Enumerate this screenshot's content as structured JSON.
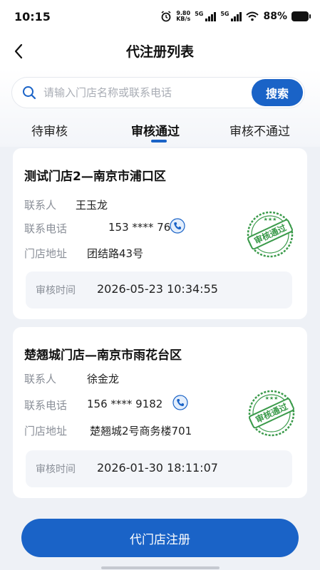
{
  "status_bar": {
    "time": "10:15",
    "net_speed_value": "9.80",
    "net_speed_unit": "KB/s",
    "sim1": "5G",
    "sim2": "5G",
    "battery": "88%"
  },
  "nav": {
    "title": "代注册列表"
  },
  "search": {
    "placeholder": "请输入门店名称或联系电话",
    "value": "",
    "button_label": "搜索"
  },
  "tabs": [
    {
      "label": "待审核",
      "active": false
    },
    {
      "label": "审核通过",
      "active": true
    },
    {
      "label": "审核不通过",
      "active": false
    }
  ],
  "labels": {
    "contact": "联系人",
    "phone": "联系电话",
    "address": "门店地址",
    "review_time": "审核时间",
    "stamp_text": "审核通过"
  },
  "stores": [
    {
      "name": "测试门店2—南京市浦口区",
      "contact": "王玉龙",
      "phone": "153 **** 7619",
      "address": "团结路43号",
      "review_time": "2026-05-23 10:34:55"
    },
    {
      "name": "楚翘城门店—南京市雨花台区",
      "contact": "徐金龙",
      "phone": "156 **** 9182",
      "address": "楚翘城2号商务楼701",
      "review_time": "2026-01-30 18:11:07"
    }
  ],
  "footer": {
    "register_label": "代门店注册"
  },
  "colors": {
    "primary": "#1a63c7",
    "stamp_green": "#3a9a4a",
    "label_gray": "#8a8f98"
  },
  "icons": [
    "back-arrow-icon",
    "search-icon",
    "phone-icon",
    "approved-stamp-icon",
    "wifi-icon",
    "signal-icon",
    "alarm-icon",
    "battery-icon"
  ]
}
